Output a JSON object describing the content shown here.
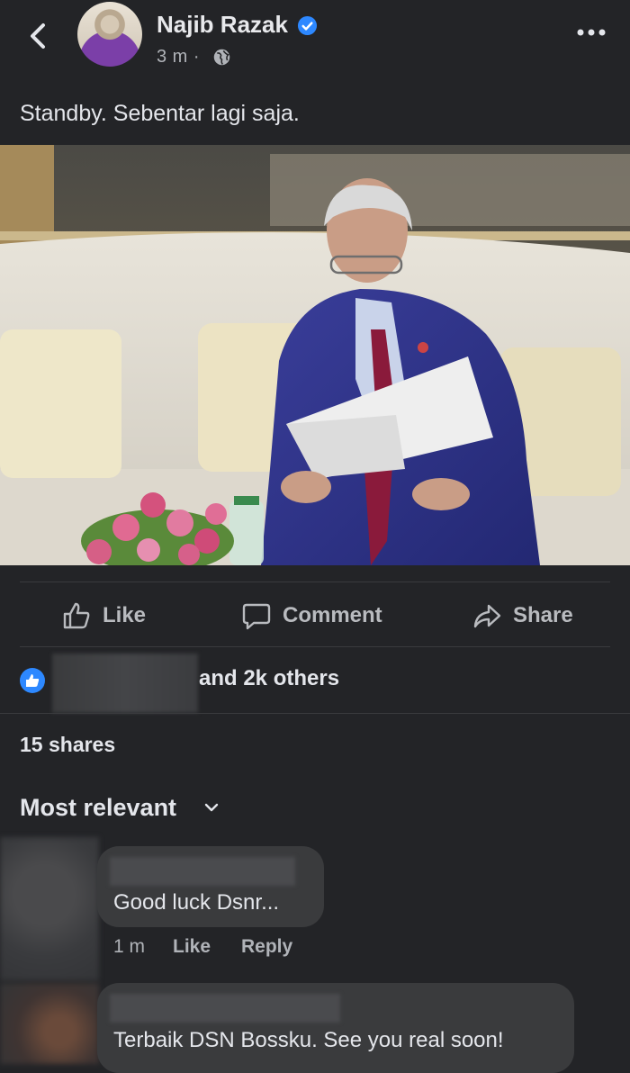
{
  "post": {
    "author": "Najib Razak",
    "time": "3 m ·",
    "text": "Standby. Sebentar lagi saja."
  },
  "actions": {
    "like": "Like",
    "comment": "Comment",
    "share": "Share"
  },
  "reactions": {
    "text": "and 2k others"
  },
  "shares": "15 shares",
  "sort": {
    "label": "Most relevant"
  },
  "comments": [
    {
      "text": "Good luck Dsnr...",
      "time": "1 m",
      "like": "Like",
      "reply": "Reply"
    },
    {
      "text": "Terbaik DSN Bossku. See you real soon!"
    }
  ],
  "icons": {
    "back": "chevron-left-icon",
    "verified": "verified-badge-icon",
    "audience": "globe-icon",
    "more": "more-dots-icon",
    "like": "thumbs-up-icon",
    "comment": "speech-bubble-icon",
    "share": "share-arrow-icon",
    "sort": "chevron-down-icon"
  },
  "colors": {
    "background": "#232427",
    "accent": "#2d88ff",
    "bubble": "#3a3b3d",
    "muted_text": "#b0b3b8"
  }
}
